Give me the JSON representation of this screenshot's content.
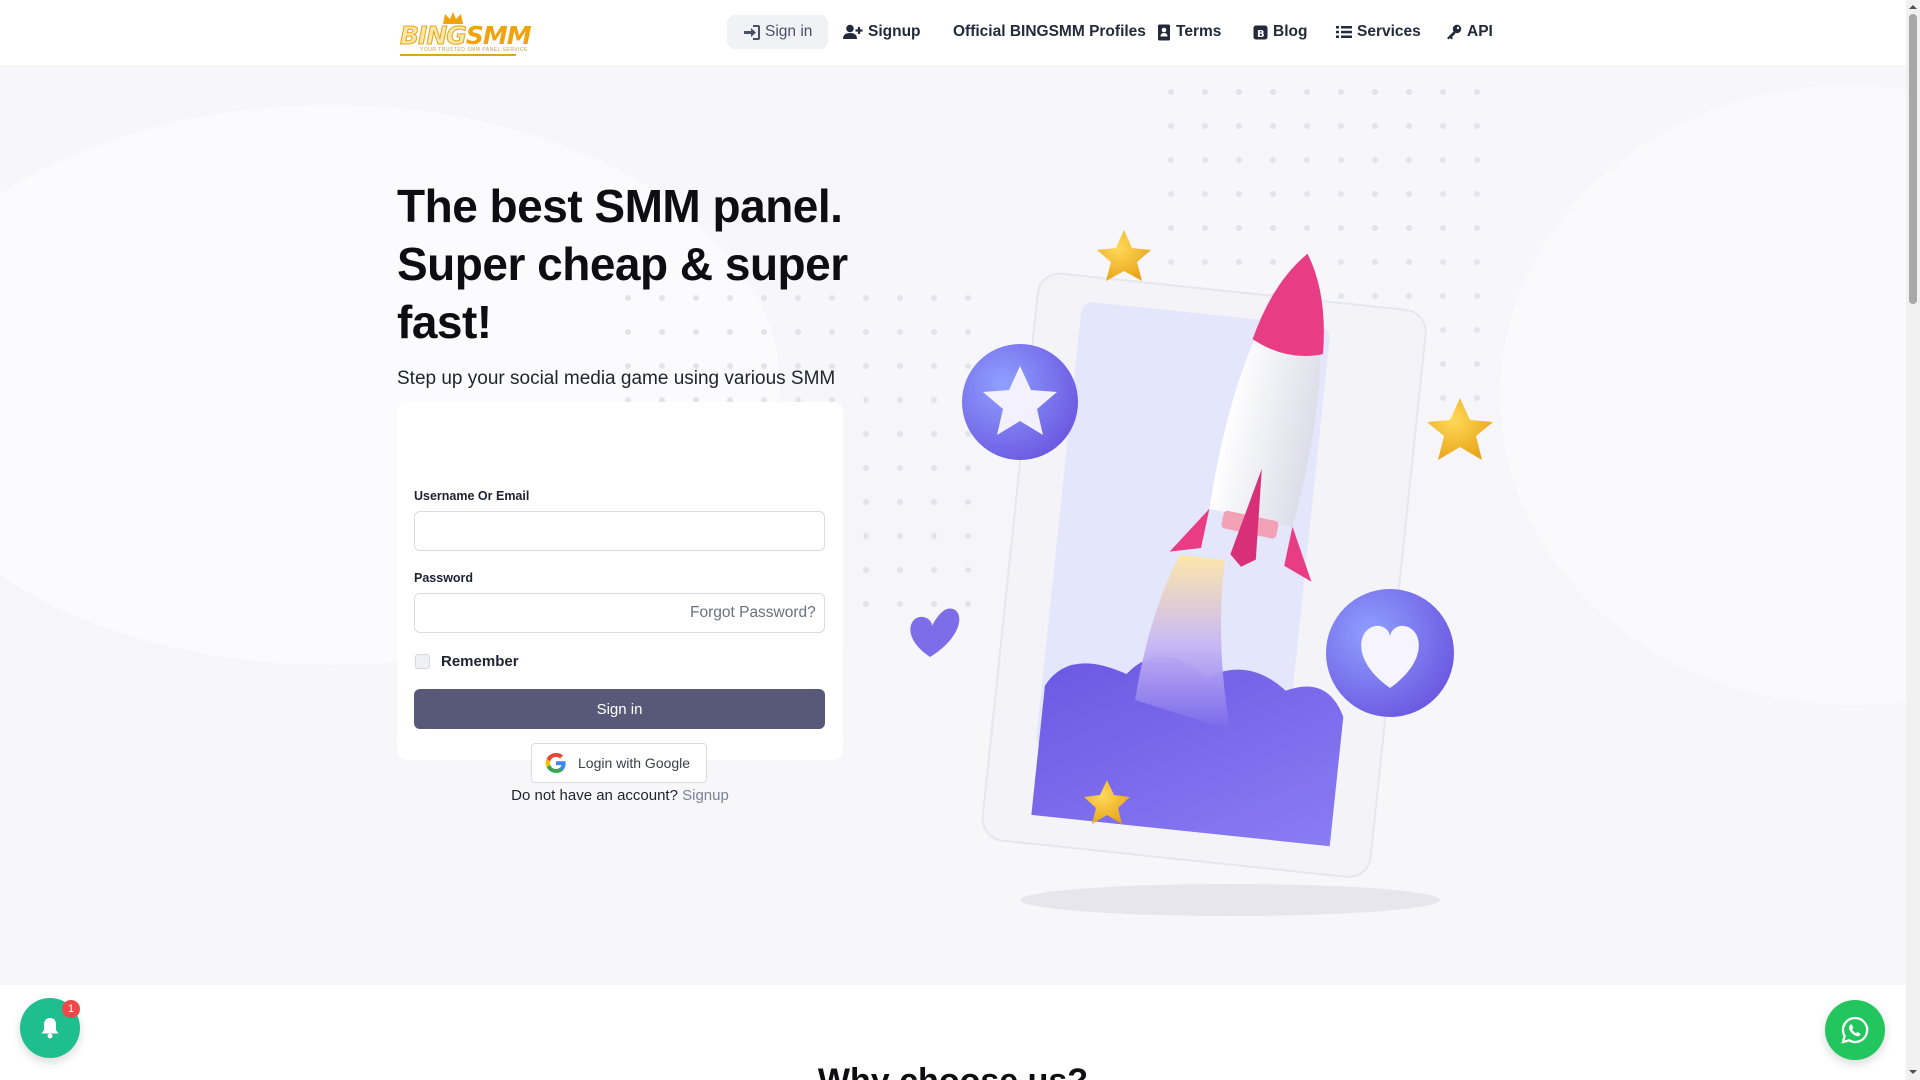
{
  "brand": {
    "logo_main": "BING",
    "logo_accent": "SMM",
    "logo_tagline": "YOUR TRUSTED SMM PANEL SERVICE"
  },
  "nav": {
    "items": [
      {
        "label": "Sign in",
        "icon": "sign-in-icon",
        "active": true
      },
      {
        "label": "Signup",
        "icon": "user-plus-icon"
      },
      {
        "label": "Official BINGSMM Profiles",
        "icon": ""
      },
      {
        "label": "Terms",
        "icon": "address-book-icon"
      },
      {
        "label": "Blog",
        "icon": "blog-icon"
      },
      {
        "label": "Services",
        "icon": "list-icon"
      },
      {
        "label": "API",
        "icon": "key-icon"
      }
    ]
  },
  "hero": {
    "headline_line1": "The best SMM panel.",
    "headline_line2": "Super cheap & super",
    "headline_line3": "fast!",
    "subline": "Step up your social media game using various SMM services that we offer."
  },
  "login_form": {
    "username_label": "Username Or Email",
    "username_value": "",
    "password_label": "Password",
    "password_value": "",
    "forgot_label": "Forgot Password?",
    "remember_label": "Remember",
    "remember_checked": false,
    "signin_label": "Sign in",
    "google_label": "Login with Google",
    "no_account_text": "Do not have an account?",
    "signup_link": "Signup"
  },
  "section_heading": "Why choose us?",
  "notification_badge": "1",
  "colors": {
    "primary_button": "#585978",
    "logo_gold": "#f0a30a",
    "whatsapp_green": "#22c55e",
    "bell_teal": "#1fbe8f",
    "rocket_pink": "#e83d84",
    "illustration_purple": "#7b6cf0"
  },
  "icons": {
    "bell": "bell-icon",
    "whatsapp": "whatsapp-icon",
    "google": "google-g-icon"
  }
}
